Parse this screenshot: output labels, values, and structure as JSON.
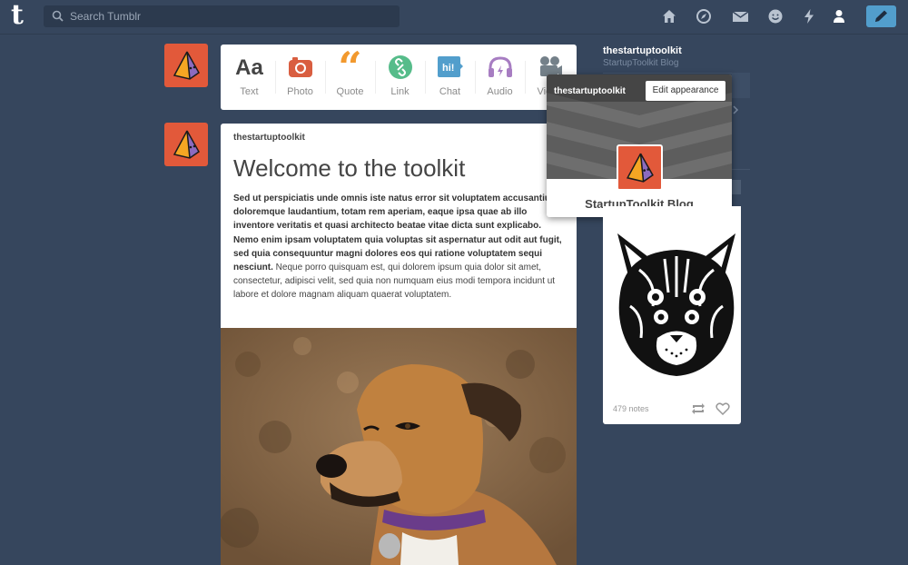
{
  "header": {
    "logo": "t",
    "search_placeholder": "Search Tumblr",
    "nav": [
      "home-icon",
      "explore-icon",
      "mail-icon",
      "messaging-icon",
      "activity-icon",
      "account-icon",
      "compose-icon"
    ],
    "accent": "#529ecc"
  },
  "post_types": [
    {
      "label": "Text",
      "icon": "text-icon",
      "color": "#444444"
    },
    {
      "label": "Photo",
      "icon": "photo-icon",
      "color": "#d95e40"
    },
    {
      "label": "Quote",
      "icon": "quote-icon",
      "color": "#f2992e"
    },
    {
      "label": "Link",
      "icon": "link-icon",
      "color": "#56bc8a"
    },
    {
      "label": "Chat",
      "icon": "chat-icon",
      "color": "#529ecc"
    },
    {
      "label": "Audio",
      "icon": "audio-icon",
      "color": "#a77dc2"
    },
    {
      "label": "Video",
      "icon": "video-icon",
      "color": "#748089"
    }
  ],
  "post": {
    "author": "thestartuptoolkit",
    "title": "Welcome to the toolkit",
    "body_bold": "Sed ut perspiciatis unde omnis iste natus error sit voluptatem accusantium doloremque laudantium, totam rem aperiam, eaque ipsa quae ab illo inventore veritatis et quasi architecto beatae vitae dicta sunt explicabo. Nemo enim ipsam voluptatem quia voluptas sit aspernatur aut odit aut fugit, sed quia consequuntur magni dolores eos qui ratione voluptatem sequi nesciunt.",
    "body_normal": " Neque porro quisquam est, qui dolorem ipsum quia dolor sit amet, consectetur, adipisci velit, sed quia non numquam eius modi tempora incidunt ut labore et dolore magnam aliquam quaerat voluptatem."
  },
  "sidebar": {
    "blog_name": "thestartuptoolkit",
    "blog_subtitle": "StartupToolkit Blog"
  },
  "popover": {
    "name": "thestartuptoolkit",
    "edit_label": "Edit appearance",
    "title": "StartupToolkit Blog"
  },
  "card": {
    "notes": "479 notes"
  },
  "colors": {
    "background": "#36465d",
    "avatar": "#e2593a"
  }
}
